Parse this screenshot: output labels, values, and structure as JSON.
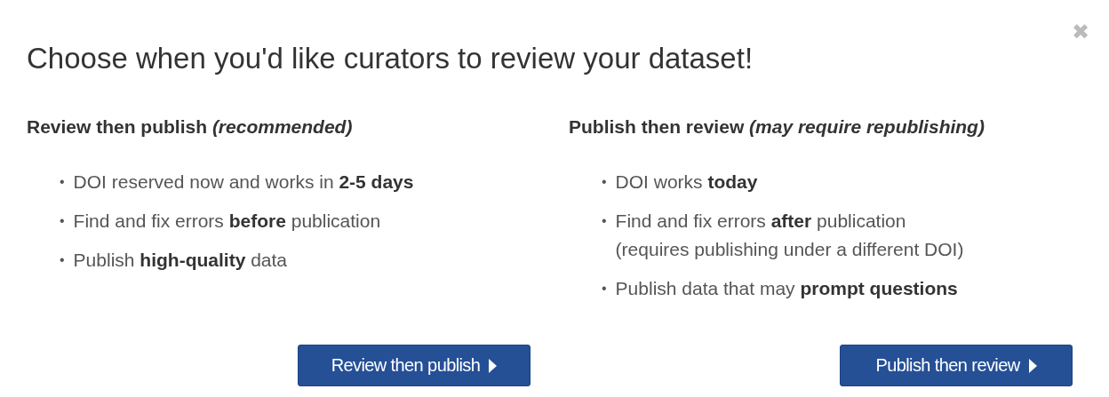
{
  "dialog": {
    "title": "Choose when you'd like curators to review your dataset!",
    "close": "✖"
  },
  "options": [
    {
      "heading": "Review then publish *(recommended)*",
      "points": [
        {
          "marker": "•",
          "text": "DOI reserved now and works in **2-5 days**"
        },
        {
          "marker": "•",
          "text": "Find and fix errors **before** publication"
        },
        {
          "marker": "•",
          "text": "Publish **high-quality** data"
        }
      ],
      "button": "Review then publish"
    },
    {
      "heading": "Publish then review *(may require republishing)*",
      "points": [
        {
          "marker": "•",
          "text": "DOI works **today**"
        },
        {
          "marker": "•",
          "text": "Find and fix errors **after** publication",
          "note": "(requires publishing under a different DOI)"
        },
        {
          "marker": "•",
          "text": "Publish data that may **prompt questions**"
        }
      ],
      "button": "Publish then review"
    }
  ]
}
